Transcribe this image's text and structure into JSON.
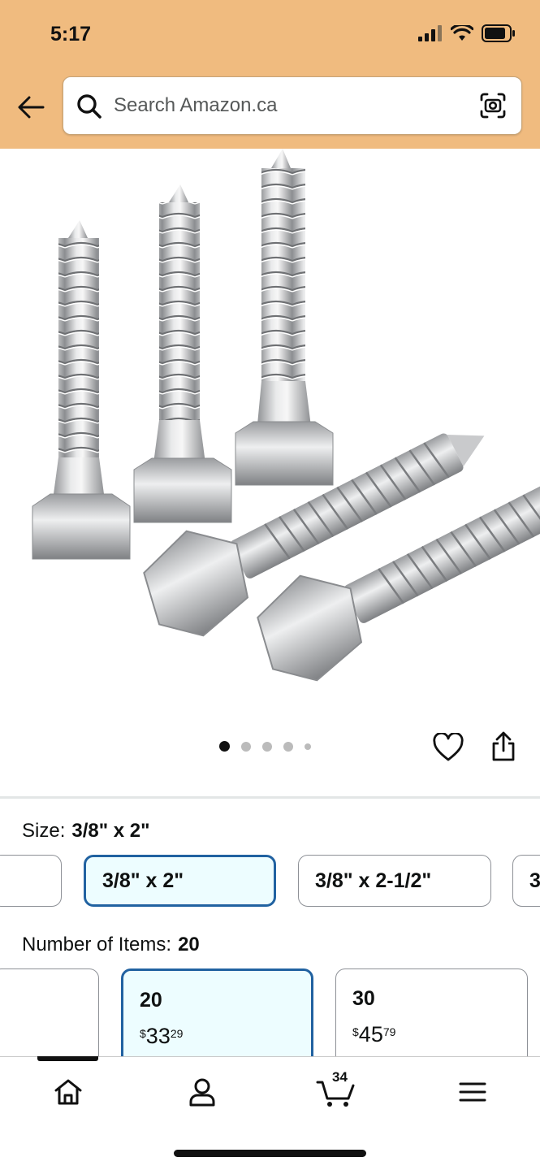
{
  "status": {
    "time": "5:17"
  },
  "search": {
    "placeholder": "Search Amazon.ca"
  },
  "gallery": {
    "dots": 5,
    "active_dot": 0
  },
  "size": {
    "label": "Size:",
    "selected": "3/8\" x 2\"",
    "options": [
      "",
      "3/8\" x 2\"",
      "3/8\" x 2-1/2\"",
      "3"
    ]
  },
  "items": {
    "label": "Number of Items:",
    "selected": "20",
    "cards": [
      {
        "qty": "",
        "price_symbol": "",
        "price_whole": "",
        "price_cents": ""
      },
      {
        "qty": "20",
        "price_symbol": "$",
        "price_whole": "33",
        "price_cents": "29"
      },
      {
        "qty": "30",
        "price_symbol": "$",
        "price_whole": "45",
        "price_cents": "79"
      }
    ]
  },
  "tabbar": {
    "cart_count": "34",
    "tabs": [
      "home-icon",
      "profile-icon",
      "cart-icon",
      "menu-icon"
    ]
  },
  "colors": {
    "header": "#f0bb7f",
    "selected_border": "#2162a1",
    "selected_bg": "#edfdff"
  }
}
